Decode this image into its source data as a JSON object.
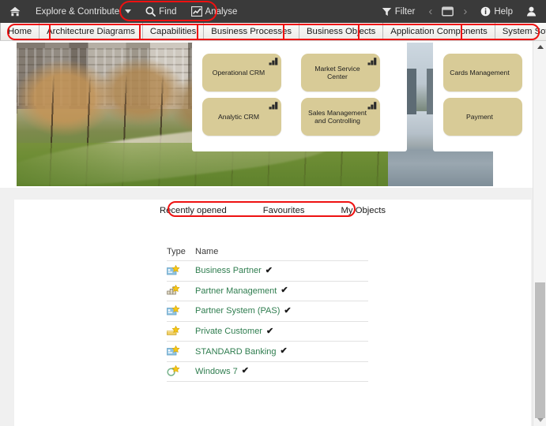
{
  "topbar": {
    "home_icon": "home-icon",
    "explore_label": "Explore & Contribute",
    "find_label": "Find",
    "find_icon": "search-icon",
    "analyse_label": "Analyse",
    "analyse_icon": "chart-line-icon",
    "filter_label": "Filter",
    "filter_icon": "funnel-icon",
    "prev_icon": "chevron-left-icon",
    "window_icon": "window-icon",
    "next_icon": "chevron-right-icon",
    "help_label": "Help",
    "help_icon": "info-icon",
    "user_icon": "user-avatar-icon"
  },
  "tabs": [
    {
      "label": "Home"
    },
    {
      "label": "Architecture Diagrams"
    },
    {
      "label": "Capabilities"
    },
    {
      "label": "Business Processes"
    },
    {
      "label": "Business Objects"
    },
    {
      "label": "Application Components"
    },
    {
      "label": "System Software"
    }
  ],
  "banner": {
    "nodes": [
      {
        "label": "Operational CRM",
        "icon": "application-component-icon"
      },
      {
        "label": "Market Service Center",
        "icon": "application-component-icon"
      },
      {
        "label": "Cards Management",
        "icon": "application-component-icon"
      },
      {
        "label": "Analytic CRM",
        "icon": "application-component-icon"
      },
      {
        "label": "Sales Management and Controlling",
        "icon": "application-component-icon"
      },
      {
        "label": "Payment",
        "icon": "application-component-icon"
      }
    ]
  },
  "subtabs": [
    {
      "label": "Recently opened"
    },
    {
      "label": "Favourites"
    },
    {
      "label": "My Objects"
    }
  ],
  "table": {
    "headers": {
      "type": "Type",
      "name": "Name"
    },
    "rows": [
      {
        "name": "Business Partner",
        "icon": "business-object-icon",
        "check": "✔"
      },
      {
        "name": "Partner Management",
        "icon": "capability-icon",
        "check": "✔"
      },
      {
        "name": "Partner System (PAS)",
        "icon": "business-object-icon",
        "check": "✔"
      },
      {
        "name": "Private Customer",
        "icon": "business-process-icon",
        "check": "✔"
      },
      {
        "name": "STANDARD Banking",
        "icon": "business-object-icon",
        "check": "✔"
      },
      {
        "name": "Windows 7",
        "icon": "system-software-icon",
        "check": "✔"
      }
    ]
  },
  "colors": {
    "topbar_bg": "#3a3a3a",
    "tab_bg": "#f1f0ee",
    "node_fill": "#d8cb97",
    "link_green": "#2f7d4f",
    "annotation_red": "#ee1111",
    "page_bg": "#f0f0f0",
    "scroll_thumb": "#bdbdbd"
  }
}
